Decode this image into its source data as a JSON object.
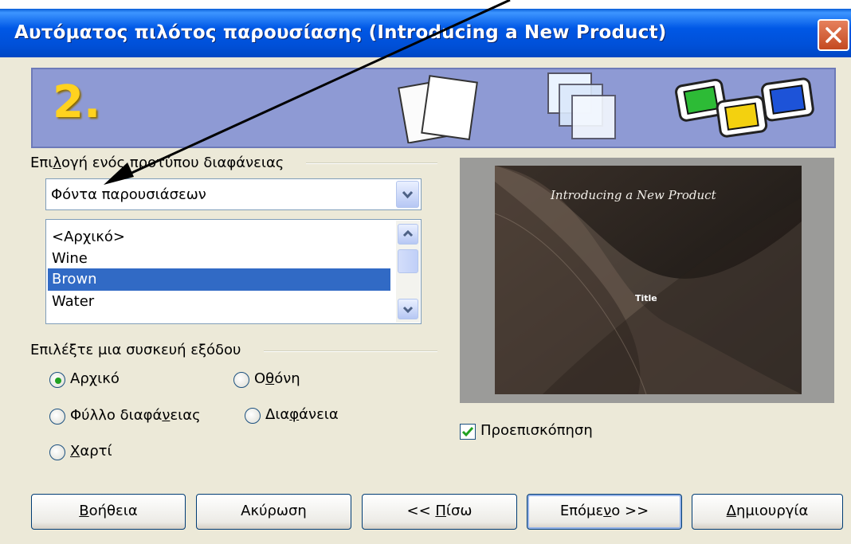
{
  "window": {
    "title": "Αυτόματος πιλότος παρουσίασης (Introducing a New Product)",
    "step_number": "2."
  },
  "template_section": {
    "heading_pre": "Επι",
    "heading_u": "λ",
    "heading_post": "ογή ενός προτύπου διαφάνειας",
    "category_value": "Φόντα παρουσιάσεων",
    "items": [
      {
        "label": "<Αρχικό>"
      },
      {
        "label": "Wine"
      },
      {
        "label": "Brown"
      },
      {
        "label": "Water"
      }
    ],
    "selected_item": "Brown"
  },
  "output_section": {
    "heading": "Επιλέξτε μια συσκευή εξόδου",
    "options": {
      "original": {
        "pre": "Αρ",
        "u": "χ",
        "post": "ικό",
        "checked": true
      },
      "screen": {
        "pre": "Ο",
        "u": "θ",
        "post": "όνη",
        "checked": false
      },
      "overhead": {
        "pre": "Φύλλο διαφά",
        "u": "ν",
        "post": "ειας",
        "checked": false
      },
      "slide": {
        "pre": "Δια",
        "u": "φ",
        "post": "άνεια",
        "checked": false
      },
      "paper": {
        "pre": "",
        "u": "Χ",
        "post": "αρτί",
        "checked": false
      }
    }
  },
  "preview": {
    "slide_title": "Introducing a New Product",
    "slide_subtitle": "Title",
    "checkbox_label": "Προεπισκόπηση",
    "checkbox_checked": true
  },
  "buttons": {
    "help": {
      "u": "Β",
      "post": "οήθεια"
    },
    "cancel": {
      "label": "Ακύρωση"
    },
    "back": {
      "pre": "<< ",
      "u": "Π",
      "post": "ίσω"
    },
    "next": {
      "pre": "Επόμε",
      "u": "ν",
      "post": "ο >>"
    },
    "create": {
      "u": "Δ",
      "post": "ημιουργία"
    }
  },
  "colors": {
    "titlebar": "#0054e3",
    "selection": "#316ac5",
    "banner": "#8e9ad4",
    "step_number": "#ffd21f",
    "radio_dot": "#21a121"
  }
}
